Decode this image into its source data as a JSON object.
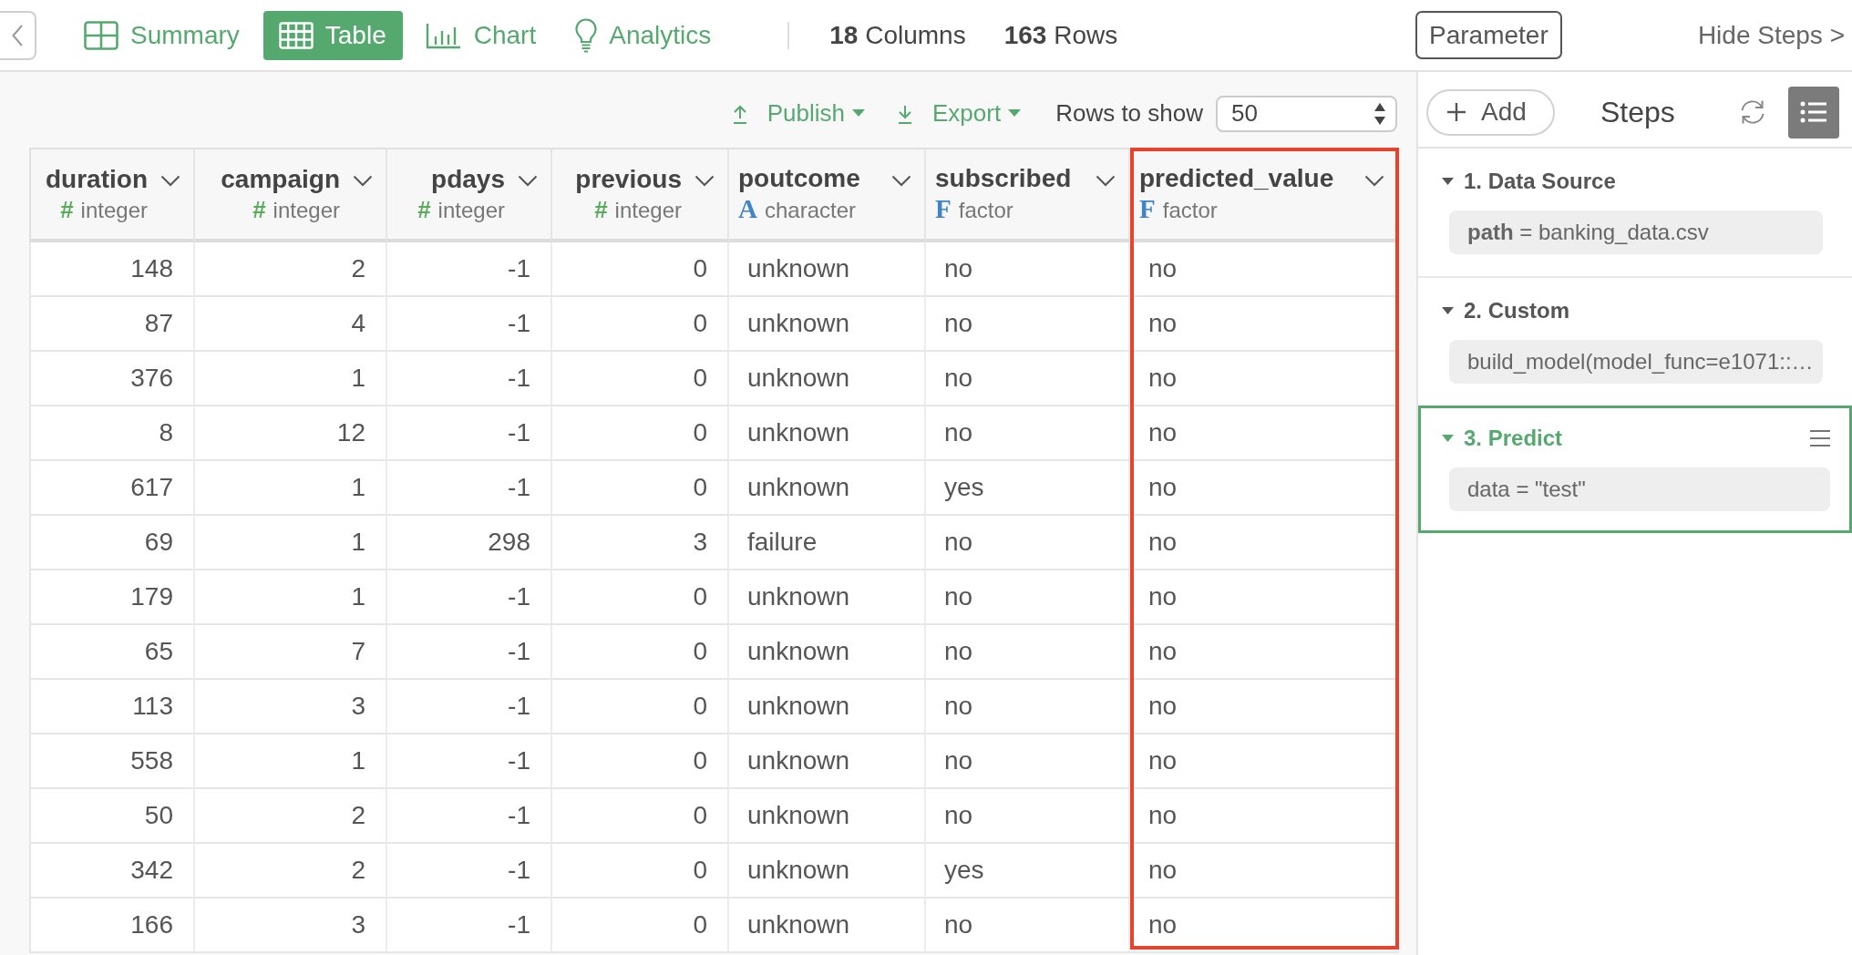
{
  "tabs": [
    {
      "label": "Summary",
      "selected": false
    },
    {
      "label": "Table",
      "selected": true
    },
    {
      "label": "Chart",
      "selected": false
    },
    {
      "label": "Analytics",
      "selected": false
    }
  ],
  "stats": [
    "**18** Columns",
    "**163** Rows"
  ],
  "parameter_button": "Parameter",
  "hide_steps": "Hide Steps >",
  "toolbar": {
    "publish": "Publish",
    "export": "Export",
    "rows_label": "Rows to show",
    "rows_value": "50"
  },
  "table": {
    "columns": [
      {
        "name": "duration",
        "symbol": "#",
        "type": "integer",
        "kind": "numeric",
        "highlighted": false
      },
      {
        "name": "campaign",
        "symbol": "#",
        "type": "integer",
        "kind": "numeric",
        "highlighted": false
      },
      {
        "name": "pdays",
        "symbol": "#",
        "type": "integer",
        "kind": "numeric",
        "highlighted": false
      },
      {
        "name": "previous",
        "symbol": "#",
        "type": "integer",
        "kind": "numeric",
        "highlighted": false
      },
      {
        "name": "poutcome",
        "symbol": "A",
        "type": "character",
        "kind": "text",
        "highlighted": false
      },
      {
        "name": "subscribed",
        "symbol": "F",
        "type": "factor",
        "kind": "text",
        "highlighted": false
      },
      {
        "name": "predicted_value",
        "symbol": "F",
        "type": "factor",
        "kind": "text",
        "highlighted": true
      }
    ],
    "rows": [
      [
        "148",
        "2",
        "-1",
        "0",
        "unknown",
        "no",
        "no"
      ],
      [
        "87",
        "4",
        "-1",
        "0",
        "unknown",
        "no",
        "no"
      ],
      [
        "376",
        "1",
        "-1",
        "0",
        "unknown",
        "no",
        "no"
      ],
      [
        "8",
        "12",
        "-1",
        "0",
        "unknown",
        "no",
        "no"
      ],
      [
        "617",
        "1",
        "-1",
        "0",
        "unknown",
        "yes",
        "no"
      ],
      [
        "69",
        "1",
        "298",
        "3",
        "failure",
        "no",
        "no"
      ],
      [
        "179",
        "1",
        "-1",
        "0",
        "unknown",
        "no",
        "no"
      ],
      [
        "65",
        "7",
        "-1",
        "0",
        "unknown",
        "no",
        "no"
      ],
      [
        "113",
        "3",
        "-1",
        "0",
        "unknown",
        "no",
        "no"
      ],
      [
        "558",
        "1",
        "-1",
        "0",
        "unknown",
        "no",
        "no"
      ],
      [
        "50",
        "2",
        "-1",
        "0",
        "unknown",
        "no",
        "no"
      ],
      [
        "342",
        "2",
        "-1",
        "0",
        "unknown",
        "yes",
        "no"
      ],
      [
        "166",
        "3",
        "-1",
        "0",
        "unknown",
        "no",
        "no"
      ]
    ]
  },
  "steps_panel": {
    "add_button": "Add",
    "title": "Steps",
    "steps": [
      {
        "title": "1. Data Source",
        "param": "**path** = banking_data.csv",
        "expanded": true,
        "selected": false
      },
      {
        "title": "2. Custom",
        "param": "build_model(model_func=e1071::…",
        "expanded": true,
        "selected": false
      },
      {
        "title": "3. Predict",
        "param": "data = \"test\"",
        "expanded": true,
        "selected": true
      }
    ]
  }
}
